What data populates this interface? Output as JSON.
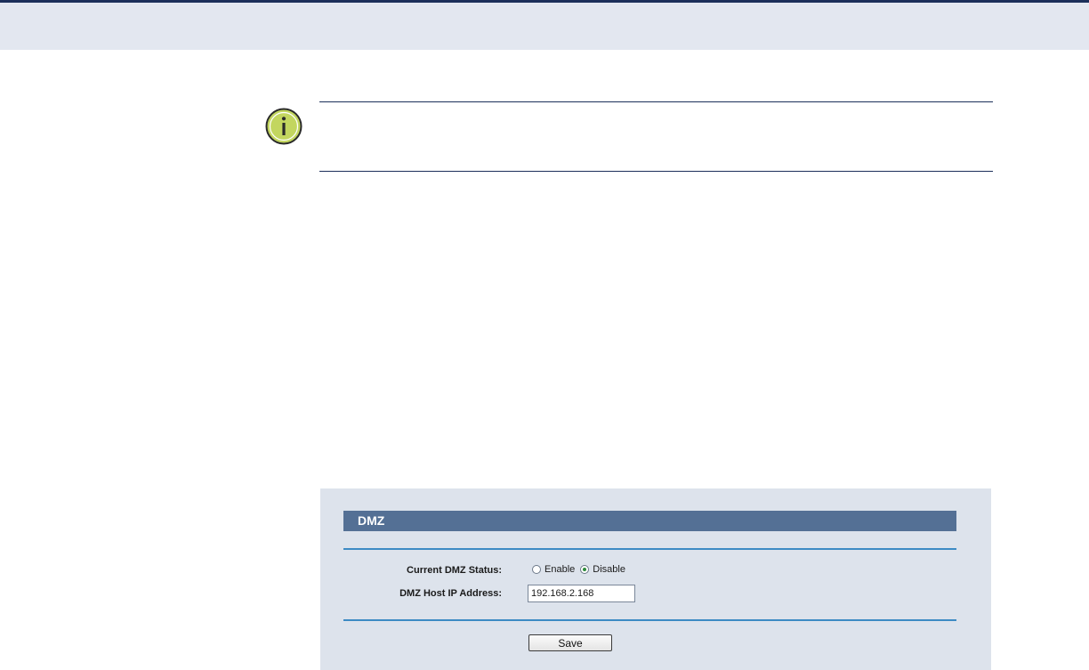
{
  "note": {
    "icon": "info-icon",
    "icon_fill": "#c3d65f",
    "text": ""
  },
  "dmz_panel": {
    "title": "DMZ",
    "status_label": "Current DMZ Status:",
    "status_options": [
      {
        "label": "Enable",
        "selected": false
      },
      {
        "label": "Disable",
        "selected": true
      }
    ],
    "host_ip_label": "DMZ Host IP Address:",
    "host_ip_value": "192.168.2.168",
    "save_label": "Save"
  },
  "colors": {
    "header_rule": "#1c2f5a",
    "header_band": "#e3e7f0",
    "panel_background": "#dde3ec",
    "title_bar": "#547095",
    "divider": "#3d8bc4"
  }
}
